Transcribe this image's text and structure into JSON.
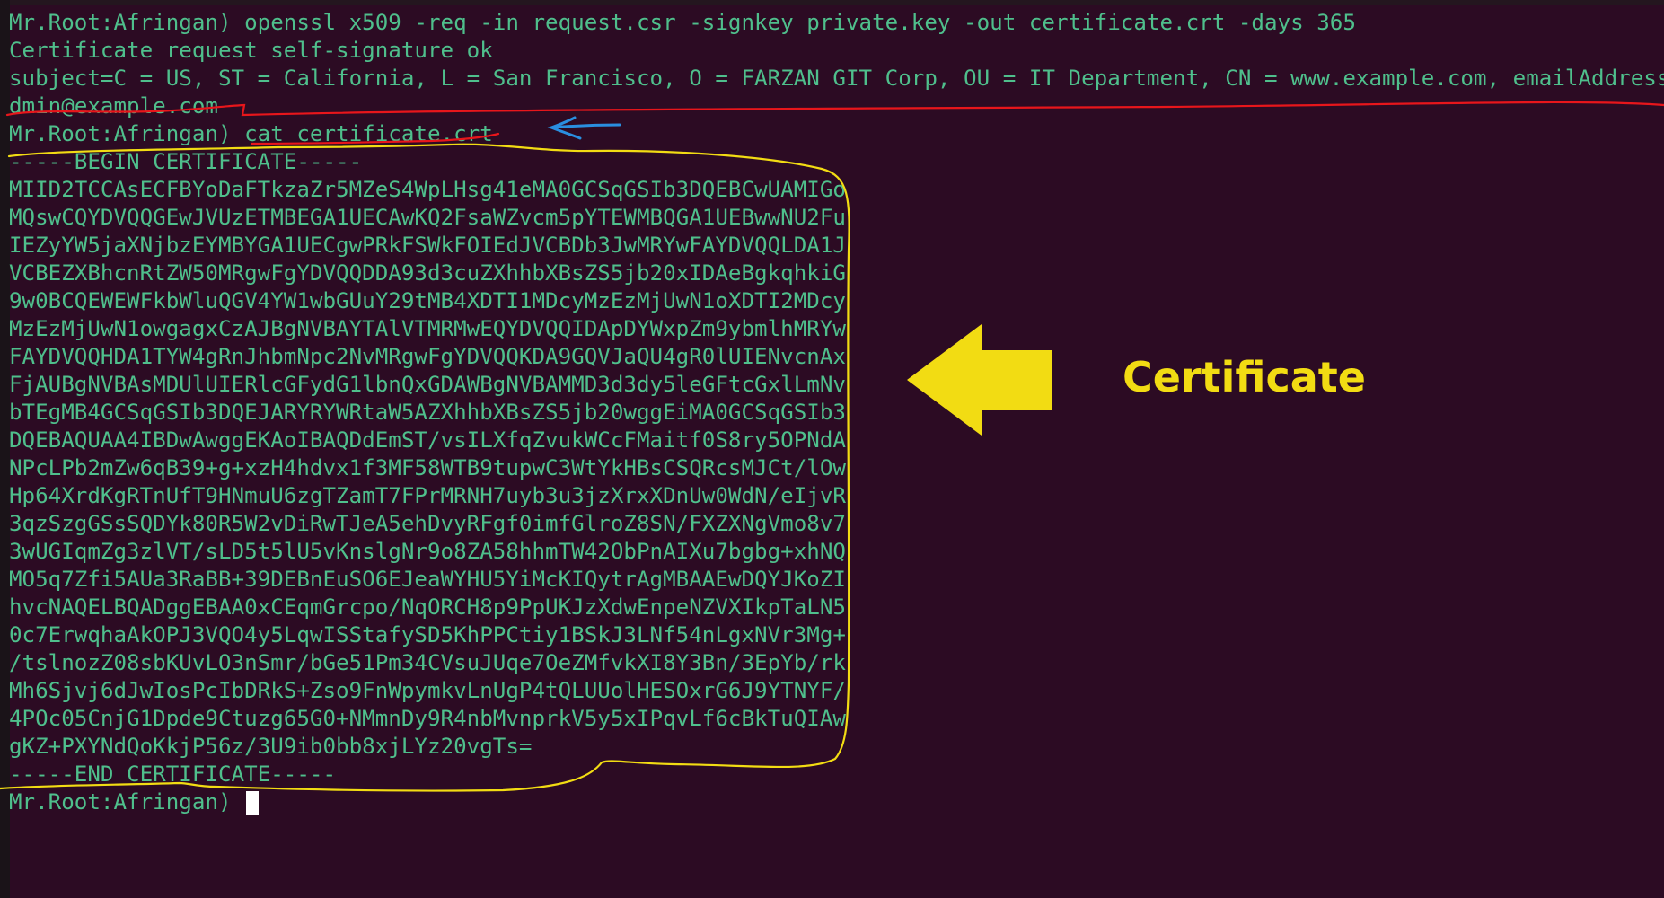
{
  "terminal": {
    "prompt": "Mr.Root:Afringan)",
    "lines": [
      "Mr.Root:Afringan) openssl x509 -req -in request.csr -signkey private.key -out certificate.crt -days 365",
      "Certificate request self-signature ok",
      "subject=C = US, ST = California, L = San Francisco, O = FARZAN GIT Corp, OU = IT Department, CN = www.example.com, emailAddress = a",
      "dmin@example.com",
      "Mr.Root:Afringan) cat certificate.crt",
      "-----BEGIN CERTIFICATE-----",
      "MIID2TCCAsECFBYoDaFTkzaZr5MZeS4WpLHsg41eMA0GCSqGSIb3DQEBCwUAMIGo",
      "MQswCQYDVQQGEwJVUzETMBEGA1UECAwKQ2FsaWZvcm5pYTEWMBQGA1UEBwwNU2Fu",
      "IEZyYW5jaXNjbzEYMBYGA1UECgwPRkFSWkFOIEdJVCBDb3JwMRYwFAYDVQQLDA1J",
      "VCBEZXBhcnRtZW50MRgwFgYDVQQDDA93d3cuZXhhbXBsZS5jb20xIDAeBgkqhkiG",
      "9w0BCQEWEWFkbWluQGV4YW1wbGUuY29tMB4XDTI1MDcyMzEzMjUwN1oXDTI2MDcy",
      "MzEzMjUwN1owgagxCzAJBgNVBAYTAlVTMRMwEQYDVQQIDApDYWxpZm9ybmlhMRYw",
      "FAYDVQQHDA1TYW4gRnJhbmNpc2NvMRgwFgYDVQQKDA9GQVJaQU4gR0lUIENvcnAx",
      "FjAUBgNVBAsMDUlUIERlcGFydG1lbnQxGDAWBgNVBAMMD3d3dy5leGFtcGxlLmNv",
      "bTEgMB4GCSqGSIb3DQEJARYRYWRtaW5AZXhhbXBsZS5jb20wggEiMA0GCSqGSIb3",
      "DQEBAQUAA4IBDwAwggEKAoIBAQDdEmST/vsILXfqZvukWCcFMaitf0S8ry5OPNdA",
      "NPcLPb2mZw6qB39+g+xzH4hdvx1f3MF58WTB9tupwC3WtYkHBsCSQRcsMJCt/lOw",
      "Hp64XrdKgRTnUfT9HNmuU6zgTZamT7FPrMRNH7uyb3u3jzXrxXDnUw0WdN/eIjvR",
      "3qzSzgGSsSQDYk80R5W2vDiRwTJeA5ehDvyRFgf0imfGlroZ8SN/FXZXNgVmo8v7",
      "3wUGIqmZg3zlVT/sLD5t5lU5vKnslgNr9o8ZA58hhmTW42ObPnAIXu7bgbg+xhNQ",
      "MO5q7Zfi5AUa3RaBB+39DEBnEuSO6EJeaWYHU5YiMcKIQytrAgMBAAEwDQYJKoZI",
      "hvcNAQELBQADggEBAA0xCEqmGrcpo/NqORCH8p9PpUKJzXdwEnpeNZVXIkpTaLN5",
      "0c7ErwqhaAkOPJ3VQO4y5LqwISStafySD5KhPPCtiy1BSkJ3LNf54nLgxNVr3Mg+",
      "/tslnozZ08sbKUvLO3nSmr/bGe51Pm34CVsuJUqe7OeZMfvkXI8Y3Bn/3EpYb/rk",
      "Mh6Sjvj6dJwIosPcIbDRkS+Zso9FnWpymkvLnUgP4tQLUUolHESOxrG6J9YTNYF/",
      "4POc05CnjG1Dpde9Ctuzg65G0+NMmnDy9R4nbMvnprkV5y5xIPqvLf6cBkTuQIAw",
      "gKZ+PXYNdQoKkjP56z/3U9ib0bb8xjLYz20vgTs=",
      "-----END CERTIFICATE-----"
    ]
  },
  "annotation": {
    "label": "Certificate",
    "label_color": "#f2dc13",
    "arrow_icon": "yellow-left-arrow-icon",
    "small_arrow_icon": "blue-left-arrow-icon",
    "underline_color": "#e8161b",
    "outline_color": "#f2dc13",
    "small_arrow_color": "#2a8fe0"
  },
  "colors": {
    "background": "#2c0b23",
    "text": "#4fbf8c",
    "cursor": "#ffffff"
  }
}
